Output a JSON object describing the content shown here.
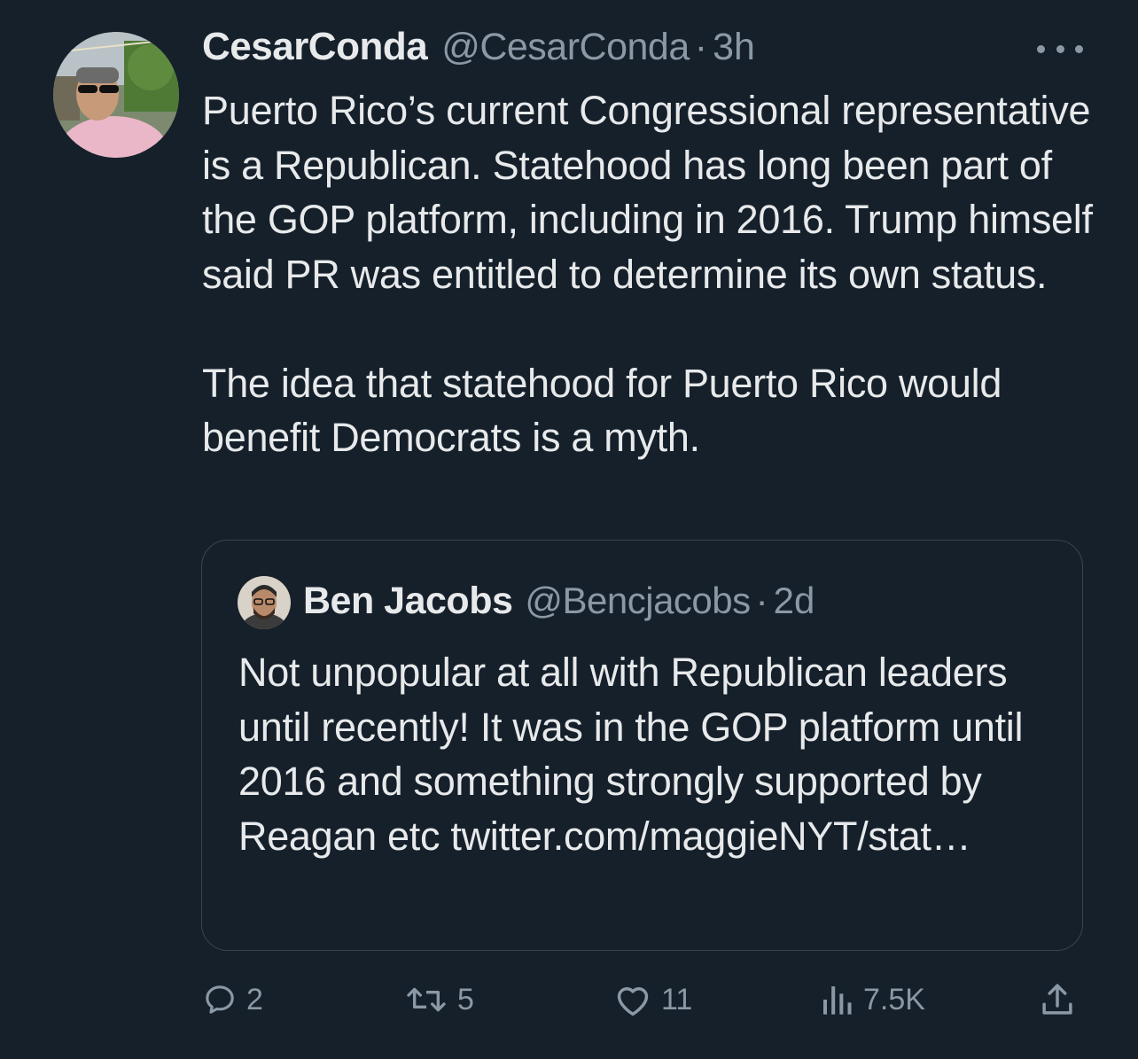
{
  "tweet": {
    "author_name": "CesarConda",
    "author_handle": "@CesarConda",
    "separator": "·",
    "time": "3h",
    "text_paragraph_1": "Puerto Rico’s current Congressional representative is a Republican. Statehood has long been part of the GOP platform, including in 2016. Trump himself said PR was entitled to determine its own status.",
    "text_paragraph_2": "The idea that statehood for Puerto Rico would benefit Democrats is a myth."
  },
  "quoted_tweet": {
    "author_name": "Ben Jacobs",
    "author_handle": "@Bencjacobs",
    "separator": "·",
    "time": "2d",
    "text": "Not unpopular at all with Republican leaders until recently! It was in the GOP platform until 2016 and something strongly supported by Reagan etc twitter.com/maggieNYT/stat…"
  },
  "actions": {
    "replies": "2",
    "retweets": "5",
    "likes": "11",
    "views": "7.5K"
  },
  "icons": {
    "more": "more-dots-icon",
    "reply": "reply-bubble-icon",
    "retweet": "retweet-icon",
    "like": "heart-icon",
    "views": "views-chart-icon",
    "share": "share-upload-icon"
  },
  "colors": {
    "background": "#15202b",
    "text_primary": "#e7e9ea",
    "text_secondary": "#8b98a5",
    "border": "#38444d"
  }
}
